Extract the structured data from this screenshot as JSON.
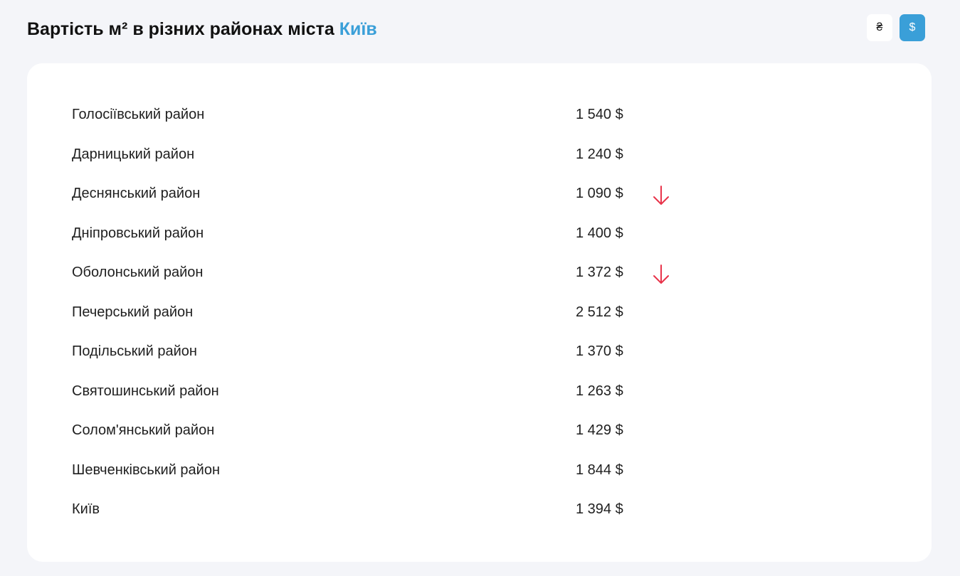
{
  "header": {
    "title_prefix": "Вартість м² в різних районах міста ",
    "city": "Київ"
  },
  "currency": {
    "options": [
      {
        "label": "₴",
        "active": false
      },
      {
        "label": "$",
        "active": true
      }
    ]
  },
  "colors": {
    "accent": "#3a9fd8",
    "trend_down": "#e8334a",
    "background": "#f4f5f9",
    "card": "#ffffff"
  },
  "districts": [
    {
      "name": "Голосіївський район",
      "price": "1 540 $",
      "trend": null
    },
    {
      "name": "Дарницький район",
      "price": "1 240 $",
      "trend": null
    },
    {
      "name": "Деснянський район",
      "price": "1 090 $",
      "trend": "down"
    },
    {
      "name": "Дніпровський район",
      "price": "1 400 $",
      "trend": null
    },
    {
      "name": "Оболонський район",
      "price": "1 372 $",
      "trend": "down"
    },
    {
      "name": "Печерський район",
      "price": "2 512 $",
      "trend": null
    },
    {
      "name": "Подільський район",
      "price": "1 370 $",
      "trend": null
    },
    {
      "name": "Святошинський район",
      "price": "1 263 $",
      "trend": null
    },
    {
      "name": "Солом'янський район",
      "price": "1 429 $",
      "trend": null
    },
    {
      "name": "Шевченківський район",
      "price": "1 844 $",
      "trend": null
    },
    {
      "name": "Київ",
      "price": "1 394 $",
      "trend": null
    }
  ]
}
